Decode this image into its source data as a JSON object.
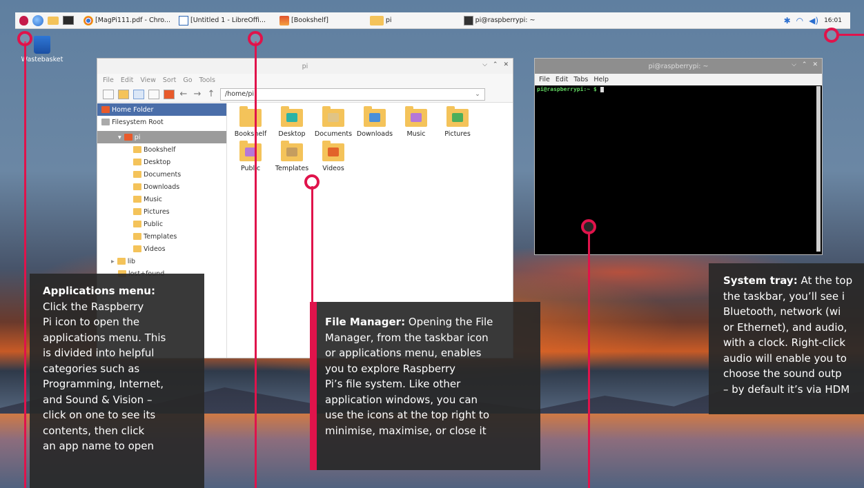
{
  "taskbar": {
    "tasks": [
      {
        "label": "[MagPi111.pdf - Chro..."
      },
      {
        "label": "[Untitled 1 - LibreOffi..."
      },
      {
        "label": "[Bookshelf]"
      },
      {
        "label": "pi"
      },
      {
        "label": "pi@raspberrypi: ~"
      }
    ],
    "clock": "16:01"
  },
  "desktop": {
    "wastebasket_label": "Wastebasket"
  },
  "file_manager": {
    "title": "pi",
    "menu": [
      "File",
      "Edit",
      "View",
      "Sort",
      "Go",
      "Tools"
    ],
    "path": "/home/pi",
    "sidebar": [
      {
        "label": "Home Folder"
      },
      {
        "label": "Filesystem Root"
      },
      {
        "label": "pi"
      },
      {
        "label": "Bookshelf"
      },
      {
        "label": "Desktop"
      },
      {
        "label": "Documents"
      },
      {
        "label": "Downloads"
      },
      {
        "label": "Music"
      },
      {
        "label": "Pictures"
      },
      {
        "label": "Public"
      },
      {
        "label": "Templates"
      },
      {
        "label": "Videos"
      },
      {
        "label": "lib"
      },
      {
        "label": "lost+found"
      }
    ],
    "items": [
      {
        "label": "Bookshelf",
        "color": "#f4c35a"
      },
      {
        "label": "Desktop",
        "color": "#2bb3a6"
      },
      {
        "label": "Documents",
        "color": "#e0c486"
      },
      {
        "label": "Downloads",
        "color": "#4a8fd8"
      },
      {
        "label": "Music",
        "color": "#b577d8"
      },
      {
        "label": "Pictures",
        "color": "#4cae5b"
      },
      {
        "label": "Public",
        "color": "#b577d8"
      },
      {
        "label": "Templates",
        "color": "#c59d5f"
      },
      {
        "label": "Videos",
        "color": "#e2632a"
      }
    ]
  },
  "terminal": {
    "title": "pi@raspberrypi: ~",
    "menu": [
      "File",
      "Edit",
      "Tabs",
      "Help"
    ],
    "prompt": "pi@raspberrypi:~ $"
  },
  "callouts": {
    "apps": {
      "heading": "Applications menu:",
      "body": "Click the Raspberry\nPi icon to open the\napplications menu. This\nis divided into helpful\ncategories such as\nProgramming, Internet,\nand Sound & Vision –\nclick on one to see its\ncontents, then click\nan app name to open"
    },
    "fm": {
      "heading": "File Manager:",
      "body": "Opening the File\nManager, from the taskbar icon\nor applications menu, enables\nyou to explore Raspberry\nPi’s file system. Like other\napplication windows, you can\nuse the icons at the top right to\nminimise, maximise, or close it"
    },
    "tray": {
      "heading": "System tray:",
      "body": "At the top\nthe taskbar, you’ll see i\nBluetooth, network (wi\nor Ethernet), and audio,\nwith a clock. Right-click\naudio will enable you to\nchoose the sound outp\n– by default it’s via HDM"
    }
  },
  "colors": {
    "accent": "#e0134b",
    "callout_bg": "#282828"
  }
}
